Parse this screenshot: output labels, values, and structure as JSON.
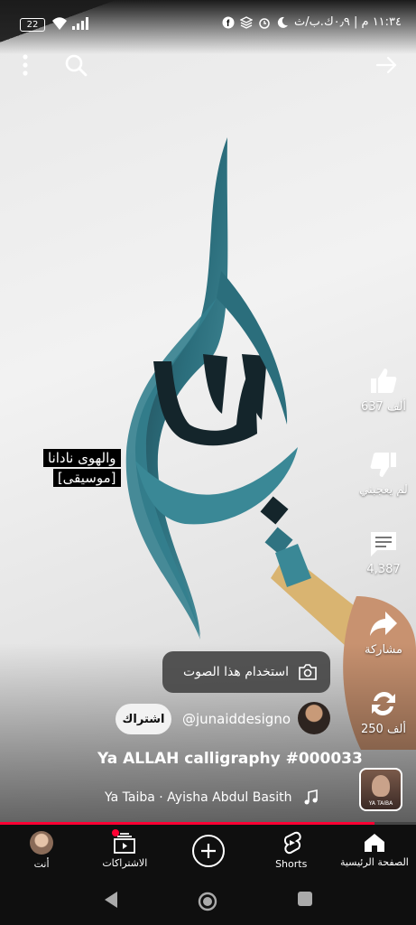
{
  "status_bar": {
    "time": "١١:٣٤ م | ٠٫٩ك.ب/ث",
    "battery": "22"
  },
  "lyrics": {
    "line1": "والهوى نادانا",
    "line2": "[موسيقى]"
  },
  "actions": {
    "like_count": "637 ألف",
    "dislike_label": "لم يعجبني",
    "comments_count": "4,387",
    "share_label": "مشاركة",
    "remix_count": "250 ألف"
  },
  "sound_popup": {
    "label": "استخدام هذا الصوت"
  },
  "channel": {
    "handle": "@junaiddesigno",
    "subscribe_label": "اشتراك"
  },
  "video": {
    "title": "Ya ALLAH calligraphy #000033",
    "music": "Ya Taiba · Ayisha Abdul Basith",
    "music_thumb_text": "YA TAIBA",
    "progress": 0.9
  },
  "bottom_nav": {
    "home": "الصفحة الرئيسية",
    "shorts": "Shorts",
    "subscriptions": "الاشتراكات",
    "you": "أنت"
  },
  "colors": {
    "accent": "#ff0033",
    "nav_bg": "#0f0f0f",
    "ink": "#2b6e7c"
  }
}
